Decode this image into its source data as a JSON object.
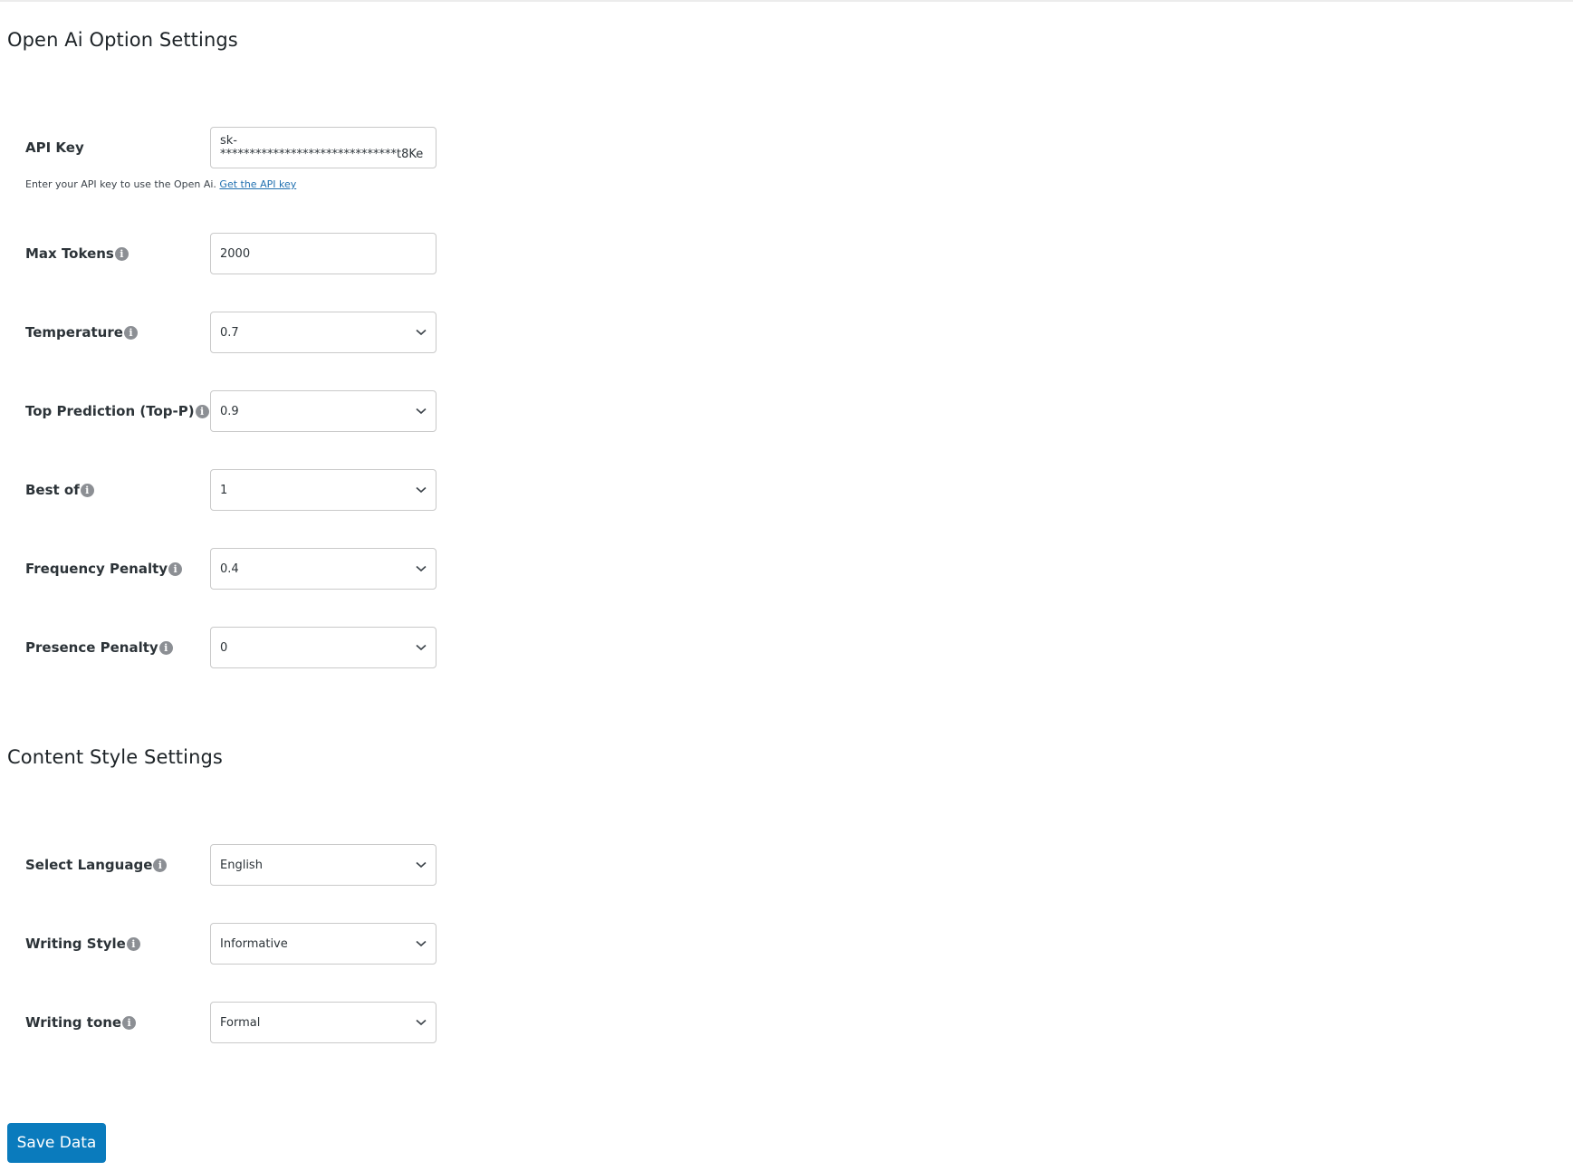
{
  "sections": {
    "openai": {
      "title": "Open Ai Option Settings",
      "api_key": {
        "label": "API Key",
        "value": "sk-******************************t8Ke",
        "help_text": "Enter your API key to use the Open Ai.",
        "help_link": "Get the API key"
      },
      "max_tokens": {
        "label": "Max Tokens",
        "value": "2000"
      },
      "temperature": {
        "label": "Temperature",
        "value": "0.7"
      },
      "top_p": {
        "label": "Top Prediction (Top-P)",
        "value": "0.9"
      },
      "best_of": {
        "label": "Best of",
        "value": "1"
      },
      "frequency_penalty": {
        "label": "Frequency Penalty",
        "value": "0.4"
      },
      "presence_penalty": {
        "label": "Presence Penalty",
        "value": "0"
      }
    },
    "content_style": {
      "title": "Content Style Settings",
      "language": {
        "label": "Select Language",
        "value": "English"
      },
      "writing_style": {
        "label": "Writing Style",
        "value": "Informative"
      },
      "writing_tone": {
        "label": "Writing tone",
        "value": "Formal"
      }
    }
  },
  "icons": {
    "info": "i"
  },
  "actions": {
    "save_label": "Save Data"
  },
  "colors": {
    "primary_button": "#0a7bbd",
    "link": "#2271b1",
    "info_icon": "#8c8f94"
  }
}
